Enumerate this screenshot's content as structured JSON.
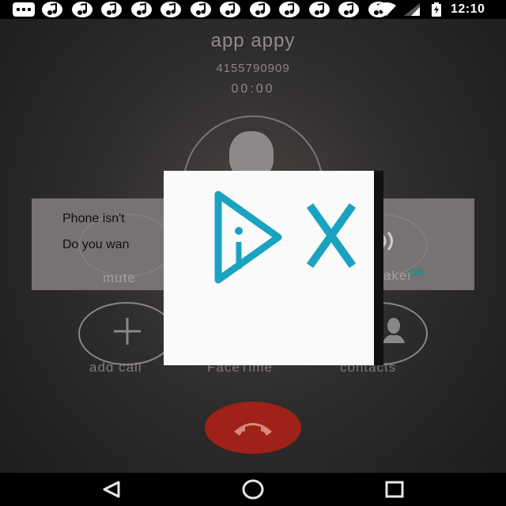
{
  "status_bar": {
    "time": "12:10",
    "notification_icons": [
      "music-note-icon",
      "music-note-icon",
      "music-note-icon",
      "music-note-icon",
      "music-note-icon",
      "music-note-icon",
      "music-note-icon",
      "music-note-icon",
      "music-note-icon",
      "music-note-icon",
      "music-note-icon",
      "music-note-icon"
    ]
  },
  "call": {
    "caller_name": "app appy",
    "phone_number": "4155790909",
    "timer": "00:00"
  },
  "dialog": {
    "line1": "Phone isn't",
    "line2": "Do you wan",
    "ok_label": "OK"
  },
  "controls": {
    "mute_label": "mute",
    "speaker_label": "aker",
    "add_call_label": "add call",
    "facetime_label": "FaceTime",
    "contacts_label": "contacts"
  },
  "ad": {
    "adchoices_icon": "adchoices-icon",
    "close_icon": "close-icon",
    "accent_color": "#1aa3c0"
  },
  "colors": {
    "end_call": "#9e2218",
    "dialog_ok": "#1d8f86"
  }
}
